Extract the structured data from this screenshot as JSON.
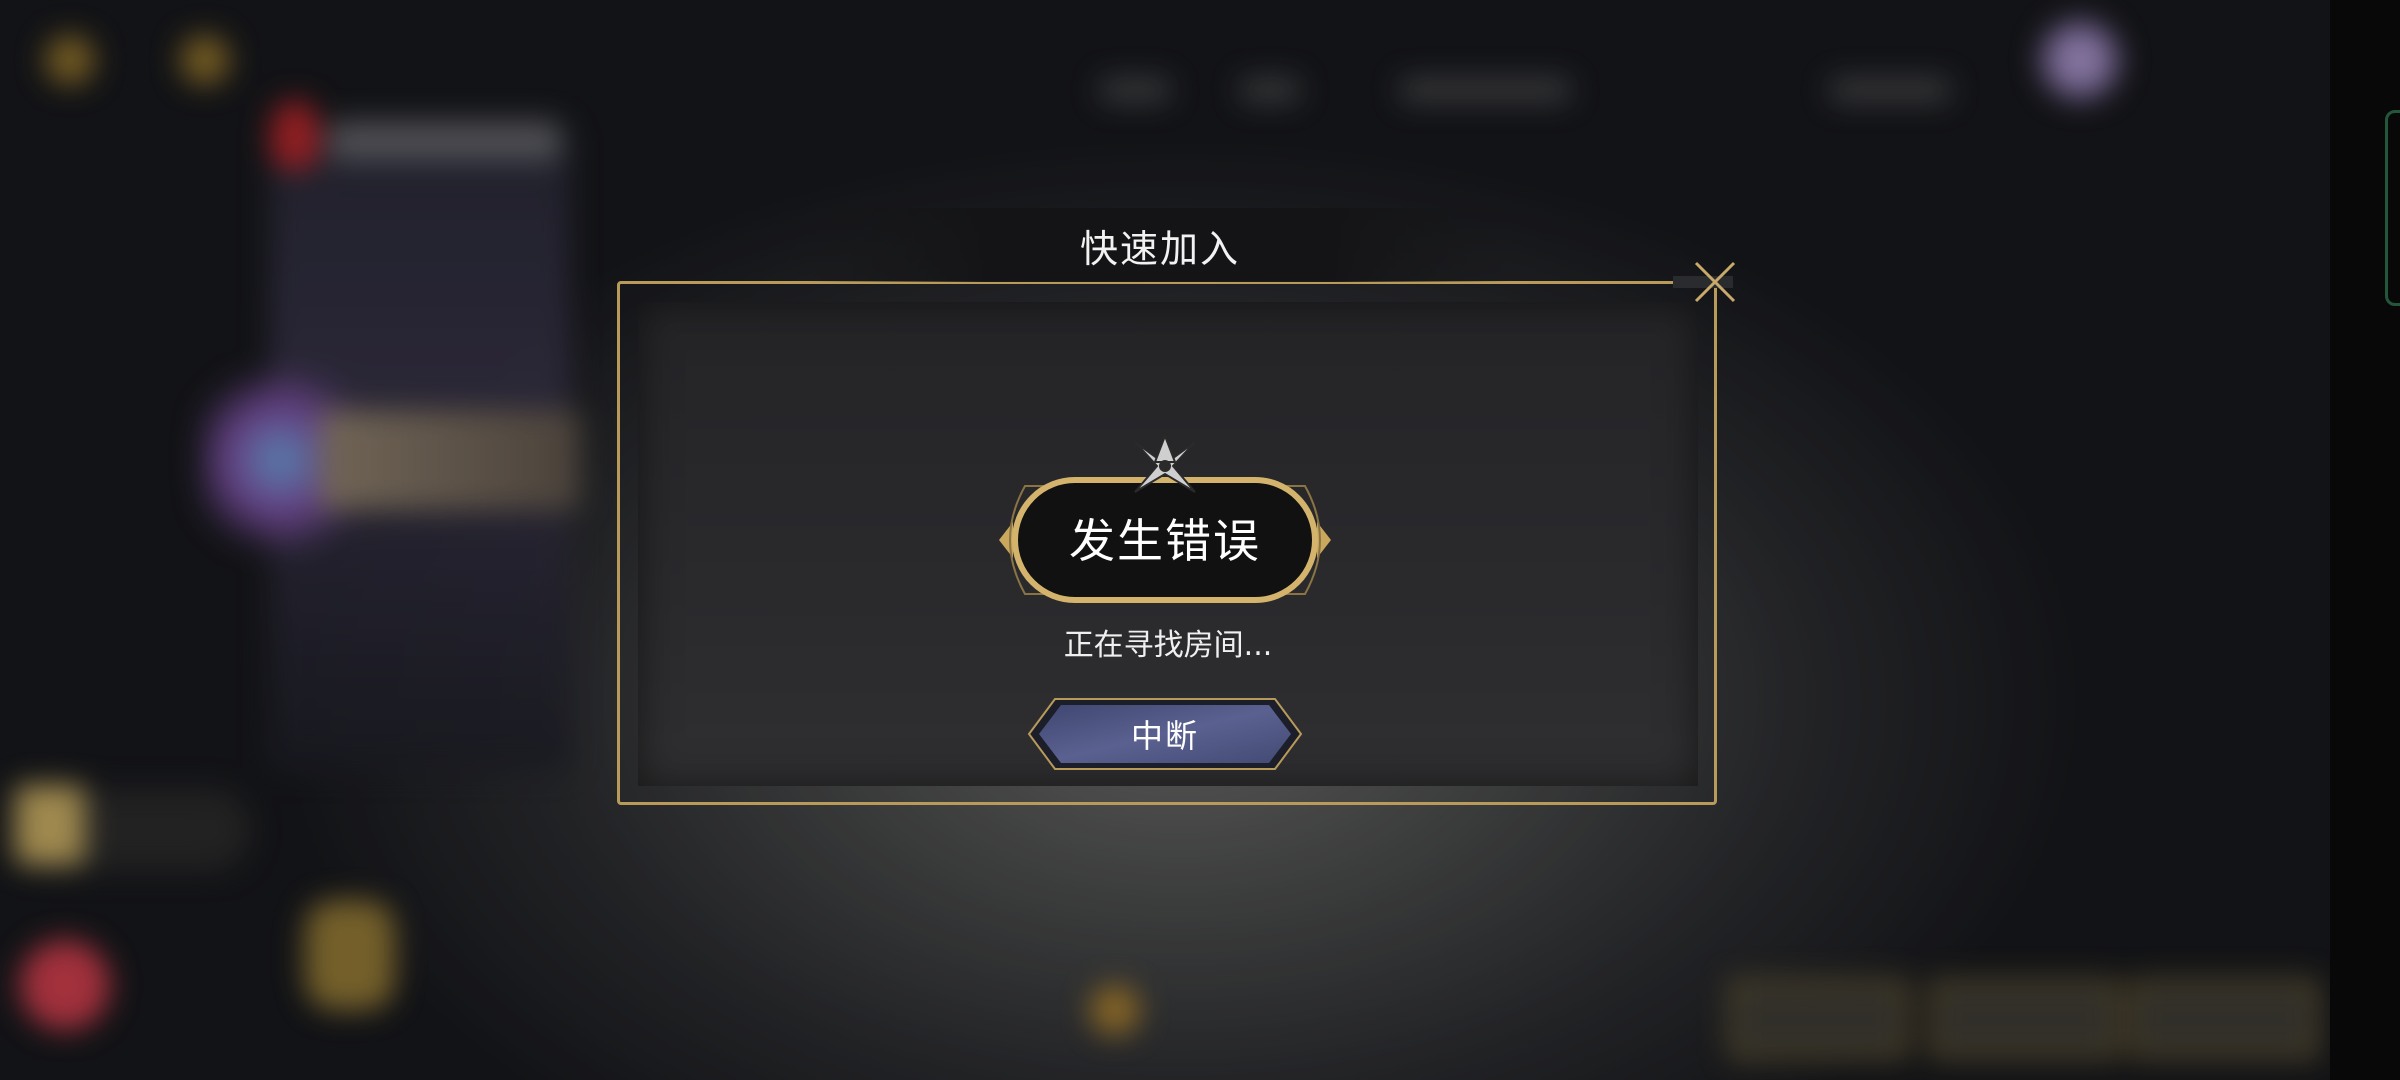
{
  "dialog": {
    "title": "快速加入",
    "badge_title": "发生错误",
    "status_message": "正在寻找房间...",
    "abort_button_label": "中断",
    "close_icon": "close-x-icon",
    "emblem_icon": "shuriken-emblem-icon"
  },
  "colors": {
    "gold_border": "#b89a5a",
    "dialog_bg": "#262629",
    "button_blue": "#4a4f78"
  }
}
